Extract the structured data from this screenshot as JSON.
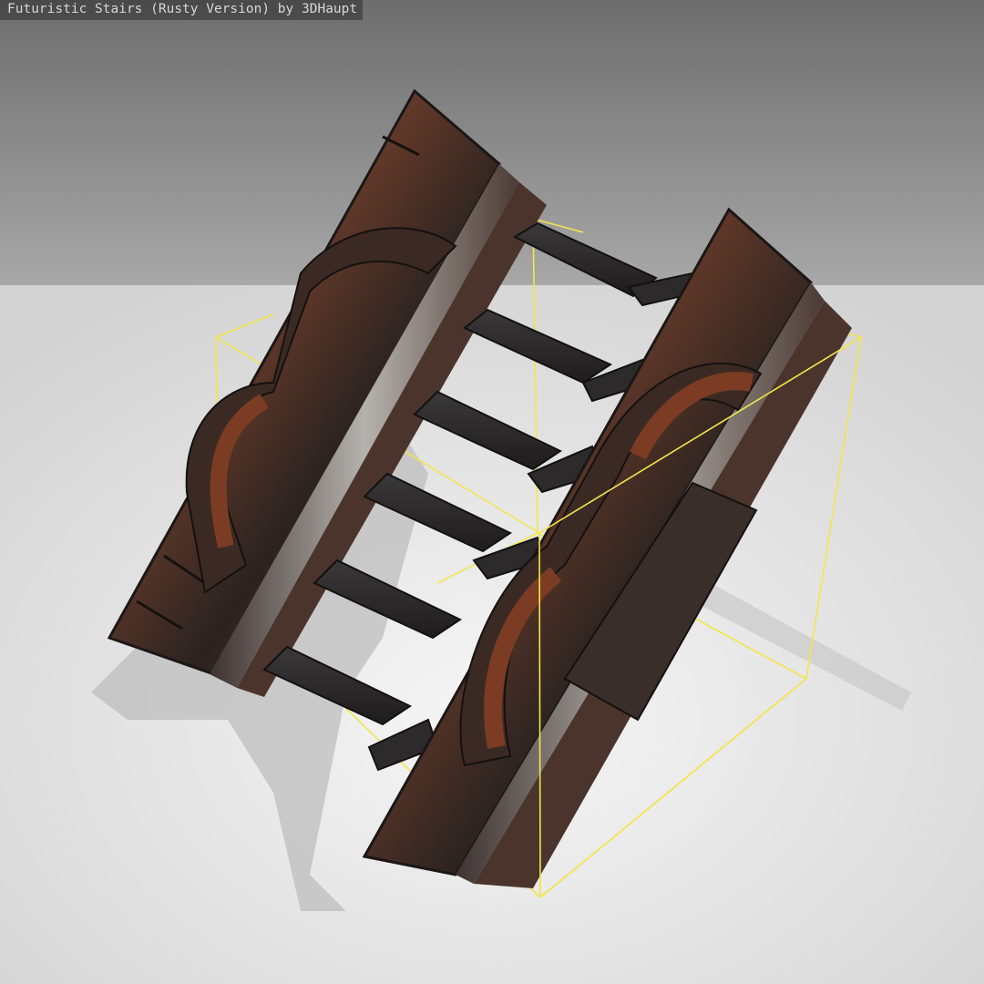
{
  "viewer": {
    "title": "Futuristic Stairs (Rusty Version) by 3DHaupt",
    "colors": {
      "sky_top": "#6d6d6d",
      "sky_bottom": "#a9a9a9",
      "floor_far": "#dcdcdc",
      "floor_near": "#f3f3f3",
      "bounding_box": "#f2e64a",
      "rust": "#7a3f26",
      "metal_dark": "#2a2624",
      "metal_light": "#9a9896",
      "step_top": "#2b2929"
    }
  }
}
